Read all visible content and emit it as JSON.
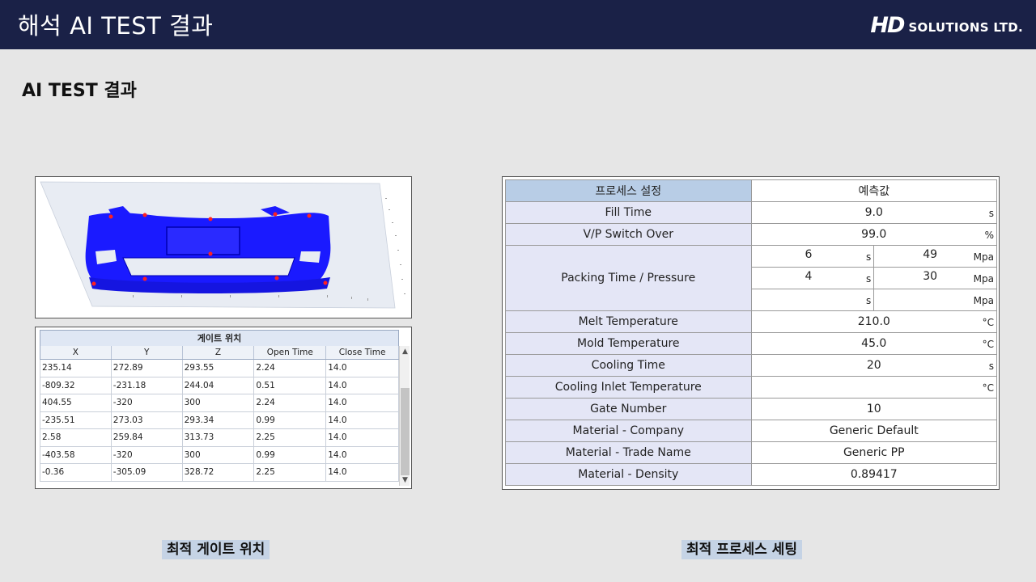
{
  "header": {
    "title": "해석 AI TEST 결과",
    "logo_mark": "HD",
    "logo_text": "SOLUTIONS LTD."
  },
  "page": {
    "subtitle": "AI TEST 결과"
  },
  "gate_table": {
    "title": "게이트 위치",
    "columns": [
      "X",
      "Y",
      "Z",
      "Open Time",
      "Close Time"
    ],
    "rows": [
      [
        "235.14",
        "272.89",
        "293.55",
        "2.24",
        "14.0"
      ],
      [
        "-809.32",
        "-231.18",
        "244.04",
        "0.51",
        "14.0"
      ],
      [
        "404.55",
        "-320",
        "300",
        "2.24",
        "14.0"
      ],
      [
        "-235.51",
        "273.03",
        "293.34",
        "0.99",
        "14.0"
      ],
      [
        "2.58",
        "259.84",
        "313.73",
        "2.25",
        "14.0"
      ],
      [
        "-403.58",
        "-320",
        "300",
        "0.99",
        "14.0"
      ],
      [
        "-0.36",
        "-305.09",
        "328.72",
        "2.25",
        "14.0"
      ]
    ]
  },
  "process_table": {
    "header_label": "프로세스 설정",
    "header_value": "예측값",
    "fill_time": {
      "label": "Fill Time",
      "value": "9.0",
      "unit": "s"
    },
    "vp_switch": {
      "label": "V/P Switch Over",
      "value": "99.0",
      "unit": "%"
    },
    "packing": {
      "label": "Packing Time / Pressure",
      "rows": [
        {
          "time": "6",
          "time_unit": "s",
          "pressure": "49",
          "pressure_unit": "Mpa"
        },
        {
          "time": "4",
          "time_unit": "s",
          "pressure": "30",
          "pressure_unit": "Mpa"
        },
        {
          "time": "",
          "time_unit": "s",
          "pressure": "",
          "pressure_unit": "Mpa"
        }
      ]
    },
    "melt_temp": {
      "label": "Melt Temperature",
      "value": "210.0",
      "unit": "°C"
    },
    "mold_temp": {
      "label": "Mold Temperature",
      "value": "45.0",
      "unit": "°C"
    },
    "cooling_time": {
      "label": "Cooling Time",
      "value": "20",
      "unit": "s"
    },
    "cooling_inlet": {
      "label": "Cooling Inlet Temperature",
      "value": "",
      "unit": "°C"
    },
    "gate_number": {
      "label": "Gate Number",
      "value": "10"
    },
    "material_company": {
      "label": "Material - Company",
      "value": "Generic Default"
    },
    "material_trade": {
      "label": "Material - Trade Name",
      "value": "Generic PP"
    },
    "material_density": {
      "label": "Material - Density",
      "value": "0.89417"
    }
  },
  "captions": {
    "left": "최적 게이트 위치",
    "right": "최적 프로세스 세팅"
  },
  "colors": {
    "header_bg": "#1a2147",
    "model_mesh": "#1a1aff",
    "gate_marker": "#ff2020",
    "caption_bg": "#c5d3e5"
  }
}
